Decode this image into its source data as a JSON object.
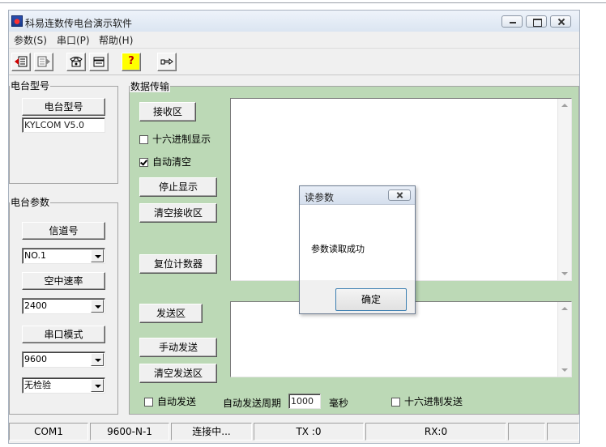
{
  "window": {
    "title": "科易连数传电台演示软件"
  },
  "menu": {
    "items": [
      "参数(S)",
      "串口(P)",
      "帮助(H)"
    ]
  },
  "toolbar": {
    "buttons": [
      "read-params-icon",
      "write-params-icon",
      "connect-phone-icon",
      "disconnect-phone-icon",
      "help-question-icon",
      "pointer-hand-icon"
    ],
    "help_glyph": "?"
  },
  "model_group": {
    "title": "电台型号",
    "model_button": "电台型号",
    "model_value": "KYLCOM V5.0"
  },
  "params_group": {
    "title": "电台参数",
    "channel_button": "信道号",
    "channel_value": "NO.1",
    "air_rate_button": "空中速率",
    "air_rate_value": "2400",
    "serial_mode_button": "串口模式",
    "serial_mode_value": "9600",
    "parity_value": "无检验"
  },
  "data_group": {
    "title": "数据传输",
    "receive_label": "接收区",
    "hex_display": "十六进制显示",
    "auto_clear": "自动清空",
    "auto_clear_checked": true,
    "stop_display": "停止显示",
    "clear_receive": "清空接收区",
    "reset_counter": "复位计数器",
    "send_label": "发送区",
    "manual_send": "手动发送",
    "clear_send": "清空发送区",
    "auto_send": "自动发送",
    "auto_send_period_label": "自动发送周期",
    "auto_send_period_value": "1000",
    "period_unit": "毫秒",
    "hex_send": "十六进制发送"
  },
  "statusbar": {
    "port": "COM1",
    "settings": "9600-N-1",
    "state": "连接中...",
    "tx": "TX :0",
    "rx": "RX:0"
  },
  "dialog": {
    "title": "读参数",
    "message": "参数读取成功",
    "ok": "确定"
  }
}
